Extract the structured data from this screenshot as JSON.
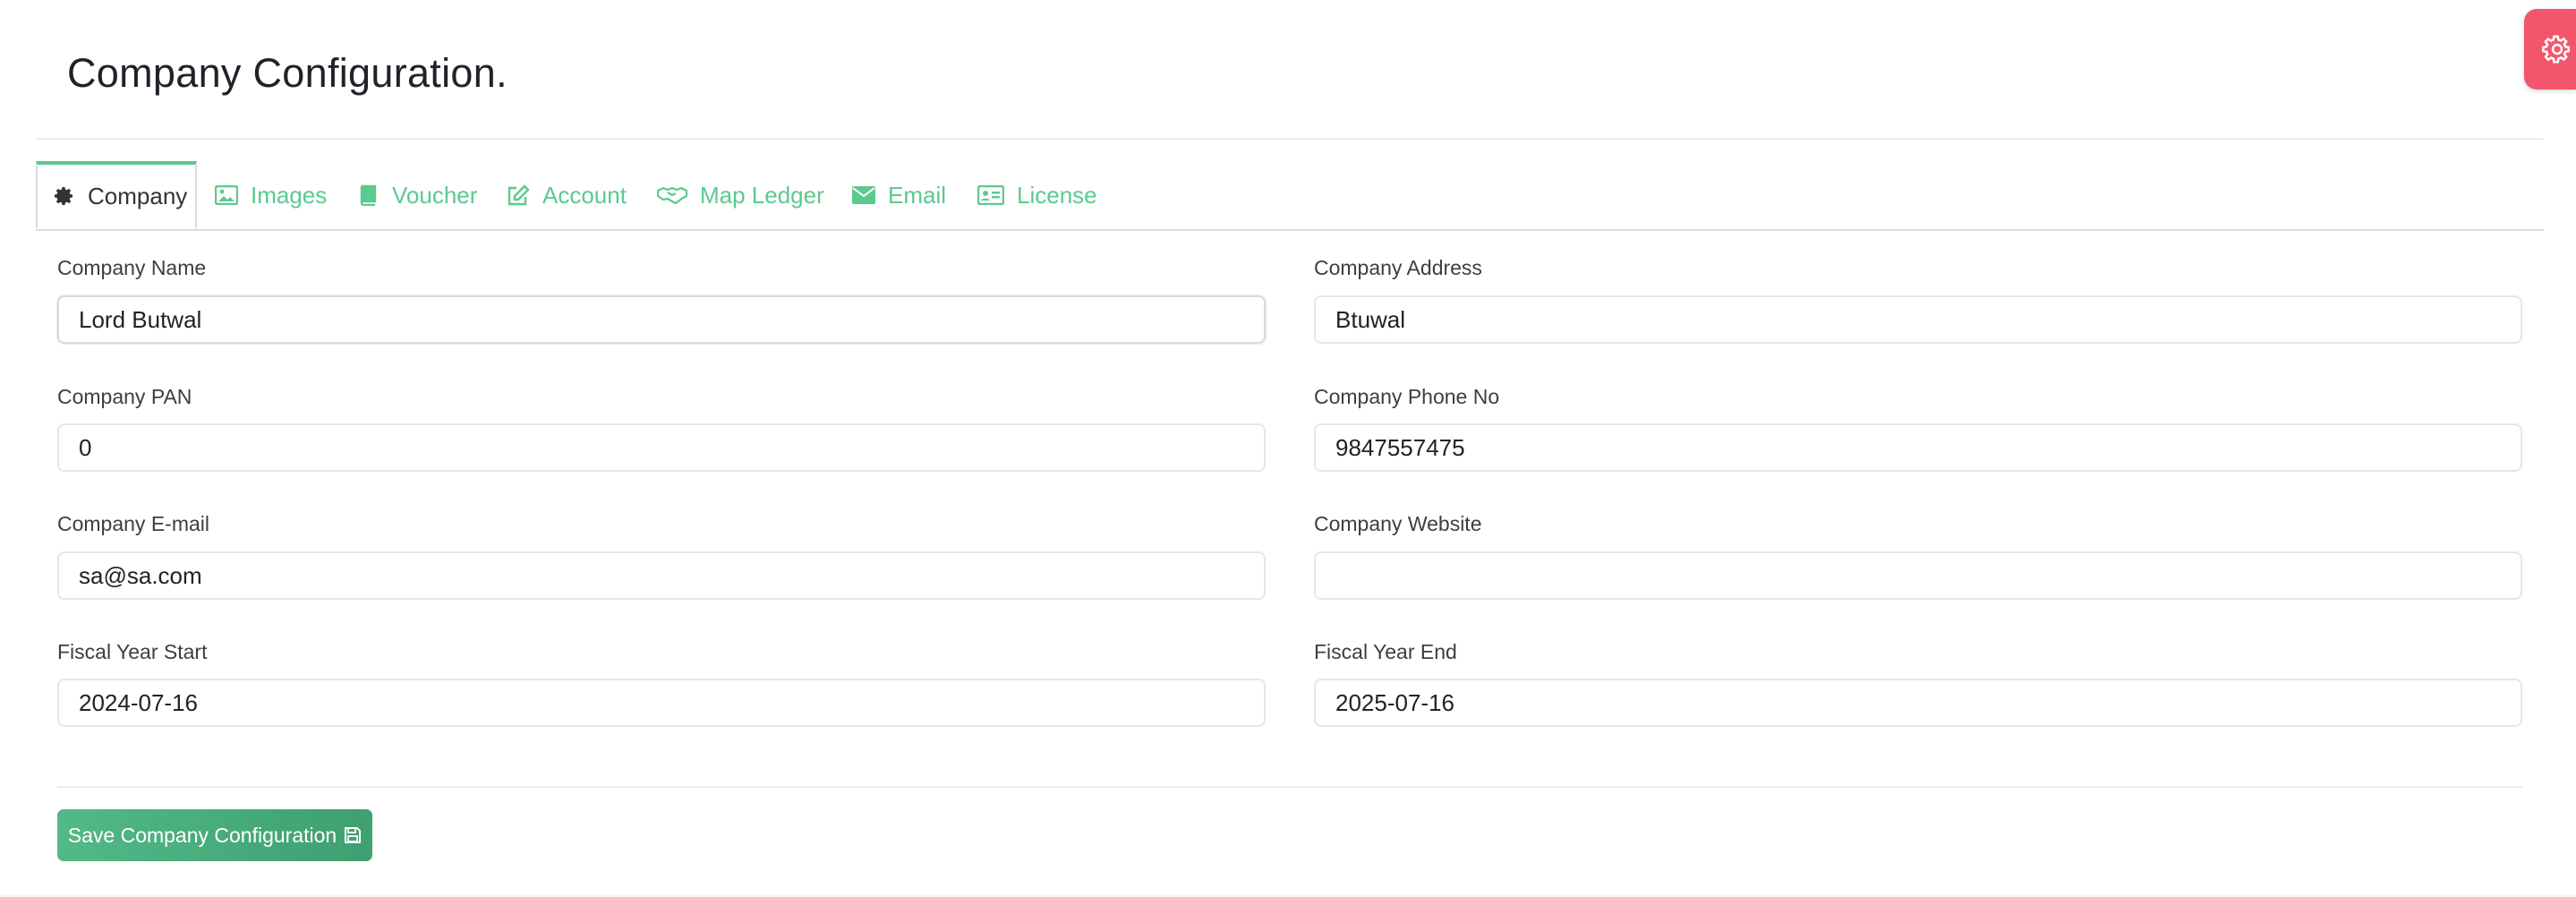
{
  "page": {
    "title": "Company Configuration."
  },
  "tabs": [
    {
      "label": "Company",
      "icon": "gear-icon",
      "active": true
    },
    {
      "label": "Images",
      "icon": "image-icon",
      "active": false
    },
    {
      "label": "Voucher",
      "icon": "book-icon",
      "active": false
    },
    {
      "label": "Account",
      "icon": "edit-icon",
      "active": false
    },
    {
      "label": "Map Ledger",
      "icon": "handshake-icon",
      "active": false
    },
    {
      "label": "Email",
      "icon": "envelope-icon",
      "active": false
    },
    {
      "label": "License",
      "icon": "id-card-icon",
      "active": false
    }
  ],
  "form": {
    "company_name": {
      "label": "Company Name",
      "value": "Lord Butwal"
    },
    "company_address": {
      "label": "Company Address",
      "value": "Btuwal"
    },
    "company_pan": {
      "label": "Company PAN",
      "value": "0"
    },
    "company_phone": {
      "label": "Company Phone No",
      "value": "9847557475"
    },
    "company_email": {
      "label": "Company E-mail",
      "value": "sa@sa.com"
    },
    "company_website": {
      "label": "Company Website",
      "value": ""
    },
    "fiscal_start": {
      "label": "Fiscal Year Start",
      "value": "2024-07-16"
    },
    "fiscal_end": {
      "label": "Fiscal Year End",
      "value": "2025-07-16"
    }
  },
  "actions": {
    "save_label": "Save Company Configuration"
  },
  "colors": {
    "accent_green": "#5cc98f",
    "save_button": "#4aab7c",
    "settings_fab": "#f2566c"
  }
}
